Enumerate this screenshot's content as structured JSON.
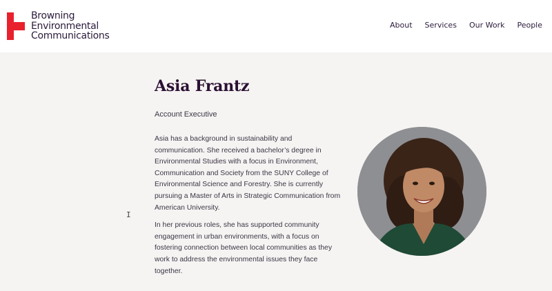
{
  "brand": {
    "line1": "Browning",
    "line2": "Environmental",
    "line3": "Communications",
    "logo_color": "#e8212d",
    "text_color": "#2b1b3a"
  },
  "nav": {
    "items": [
      "About",
      "Services",
      "Our Work",
      "People"
    ]
  },
  "profile": {
    "name": "Asia Frantz",
    "role": "Account Executive",
    "bio_p1": "Asia has a background in sustainability and communication. She received a bachelor’s degree in Environmental Studies with a focus in Environment, Communication and Society from the SUNY College of Environmental Science and Forestry. She is currently pursuing a Master of Arts in Strategic Communication from American University.",
    "bio_p2": "In her previous roles, she has supported community engagement in urban environments, with a focus on fostering connection between local communities as they work to address the environmental issues they face together."
  },
  "icons": {
    "logo": "bec-logo-mark",
    "cursor": "text-cursor-icon"
  }
}
